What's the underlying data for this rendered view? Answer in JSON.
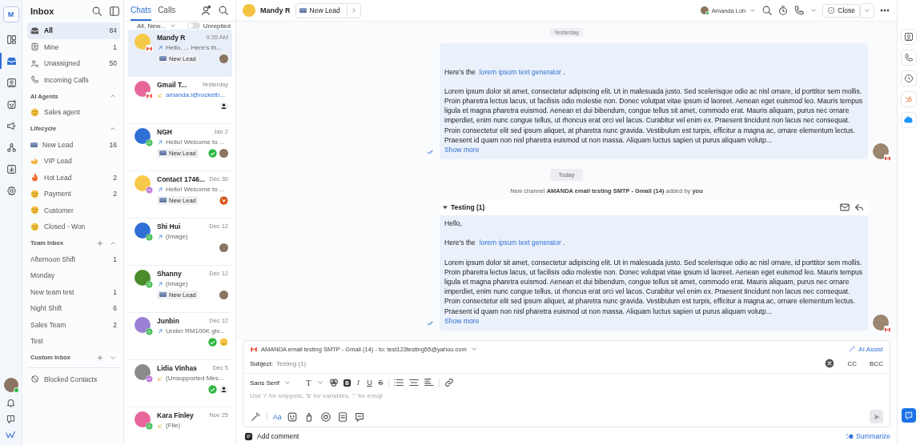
{
  "rail": {
    "logo": "M",
    "items": [
      {
        "kind": "columns",
        "selected": false
      },
      {
        "kind": "inbox",
        "selected": true
      },
      {
        "kind": "contact",
        "selected": false
      },
      {
        "kind": "bot",
        "selected": false
      },
      {
        "kind": "megaphone",
        "selected": false
      },
      {
        "kind": "flow",
        "selected": false
      },
      {
        "kind": "report",
        "selected": false
      },
      {
        "kind": "gear",
        "selected": false
      }
    ],
    "user": {
      "online": true
    }
  },
  "inbox": {
    "title": "Inbox",
    "items": [
      {
        "label": "All",
        "count": "84",
        "kind": "inbox",
        "selected": true
      },
      {
        "label": "Mine",
        "count": "1",
        "kind": "user",
        "selected": false
      },
      {
        "label": "Unassigned",
        "count": "50",
        "kind": "unassigned",
        "selected": false
      },
      {
        "label": "Incoming Calls",
        "kind": "phone",
        "selected": false
      }
    ],
    "sections": [
      {
        "title": "AI Agents",
        "expanded": true,
        "addable": false,
        "items": [
          {
            "label": "Sales agent",
            "kind": "face",
            "selected": false
          }
        ]
      },
      {
        "title": "Lifecycle",
        "expanded": true,
        "addable": false,
        "items": [
          {
            "label": "New Lead",
            "count": "16",
            "kind": "badge",
            "selected": false
          },
          {
            "label": "VIP Lead",
            "kind": "hand",
            "selected": false
          },
          {
            "label": "Hot Lead",
            "count": "2",
            "kind": "flame",
            "selected": false
          },
          {
            "label": "Payment",
            "count": "2",
            "kind": "face",
            "selected": false
          },
          {
            "label": "Customer",
            "kind": "face",
            "selected": false
          },
          {
            "label": "Closed - Won",
            "kind": "face",
            "selected": false
          }
        ]
      },
      {
        "title": "Team Inbox",
        "expanded": true,
        "addable": true,
        "items": [
          {
            "label": "Afternoon Shift",
            "count": "1",
            "selected": false
          },
          {
            "label": "Monday",
            "selected": false
          },
          {
            "label": "New team test",
            "count": "1",
            "selected": false
          },
          {
            "label": "Night Shift",
            "count": "6",
            "selected": false
          },
          {
            "label": "Sales Team",
            "count": "2",
            "selected": false
          },
          {
            "label": "Test",
            "selected": false
          }
        ]
      },
      {
        "title": "Custom Inbox",
        "expanded": false,
        "addable": true
      }
    ],
    "footer": {
      "label": "Blocked Contacts"
    }
  },
  "chat_list": {
    "tabs": [
      {
        "label": "Chats",
        "selected": true
      },
      {
        "label": "Calls",
        "selected": false
      }
    ],
    "filter": "All, New...",
    "unreplied": {
      "label": "Unreplied",
      "on": false
    },
    "chats": [
      {
        "name": "Mandy R",
        "time": "9:35 AM",
        "kind": "outgoing",
        "preview": "Hello, ... Here's th...",
        "link": false,
        "tag": "New Lead",
        "replied": false,
        "assignee": {
          "kind": "photo"
        },
        "channel": {
          "kind": "gmail"
        },
        "color": "#f7c948",
        "selected": true
      },
      {
        "name": "Gmail T...",
        "time": "Yesterday",
        "kind": "incoming",
        "preview": "amanda.l@rocketb...",
        "link": true,
        "replied": false,
        "assignee": {
          "kind": "person"
        },
        "channel": {
          "kind": "gmail"
        },
        "color": "#e8679b",
        "selected": false
      },
      {
        "name": "NGH",
        "time": "Jan 2",
        "kind": "outgoing",
        "preview": "Hello! Welcome to ...",
        "link": false,
        "tag": "New Lead",
        "replied": true,
        "assignee": {
          "kind": "photo"
        },
        "channel": {
          "kind": "whatsapp"
        },
        "color": "#2f6fd6",
        "selected": false
      },
      {
        "name": "Contact 1746...",
        "time": "Dec 30",
        "kind": "outgoing",
        "preview": "Hello! Welcome to ...",
        "link": false,
        "tag": "New Lead",
        "replied": false,
        "assignee": {
          "kind": "brand"
        },
        "channel": {
          "kind": "messenger"
        },
        "color": "#f7c948",
        "selected": false
      },
      {
        "name": "Shi Hui",
        "time": "Dec 12",
        "kind": "outgoing",
        "preview": "(Image)",
        "link": false,
        "replied": false,
        "assignee": {
          "kind": "photo"
        },
        "channel": {
          "kind": "whatsapp"
        },
        "color": "#2f6fd6",
        "selected": false
      },
      {
        "name": "Shanny",
        "time": "Dec 12",
        "kind": "outgoing",
        "preview": "(Image)",
        "link": false,
        "tag": "New Lead",
        "replied": false,
        "assignee": {
          "kind": "photo"
        },
        "channel": {
          "kind": "whatsapp"
        },
        "color": "#4a8c2a",
        "selected": false
      },
      {
        "name": "Junbin",
        "time": "Dec 12",
        "kind": "outgoing",
        "preview": "Under RM100K giv...",
        "link": false,
        "replied": true,
        "assignee": {
          "kind": "emoji"
        },
        "channel": {
          "kind": "whatsapp"
        },
        "color": "#9b7fd4",
        "selected": false
      },
      {
        "name": "Lidia Vinhas",
        "time": "Dec 5",
        "kind": "incoming",
        "preview": "(Unsupported Mes...",
        "link": false,
        "replied": true,
        "assignee": {
          "kind": "person"
        },
        "channel": {
          "kind": "messenger"
        },
        "color": "#8a8a8a",
        "selected": false
      },
      {
        "name": "Kara Finley",
        "time": "Nov 25",
        "kind": "incoming",
        "preview": "(File)",
        "link": false,
        "replied": false,
        "channel": {
          "kind": "whatsapp"
        },
        "color": "#e8679b",
        "selected": false
      }
    ]
  },
  "conversation": {
    "contact": "Mandy R",
    "stage": "New Lead",
    "agent": "Amanda Loh",
    "close_label": "Close",
    "timeline": [
      {
        "kind": "message",
        "intro": "Here's the",
        "link": "lorem ipsum text generator",
        "suffix": ".",
        "body": "Lorem ipsum dolor sit amet, consectetur adipiscing elit. Ut in malesuada justo. Sed scelerisque odio ac nisl ornare, id porttitor sem mollis. Proin pharetra lectus lacus, ut facilisis odio molestie non. Donec volutpat vitae ipsum id laoreet. Aenean eget euismod leo. Mauris tempus ligula et magna pharetra euismod. Aenean et dui bibendum, congue tellus sit amet, commodo erat. Mauris aliquam, purus nec ornare imperdiet, enim nunc congue tellus, ut rhoncus erat orci vel lacus. Curabitur vel enim ex. Praesent tincidunt non lacus nec consequat. Proin consectetur elit sed ipsum aliquet, at pharetra nunc gravida. Vestibulum est turpis, efficitur a magna ac, ornare elementum lectus. Praesent id quam non nisl pharetra euismod ut non massa. Aliquam luctus sapien ut purus aliquam volutp...",
        "more": "Show more"
      },
      {
        "kind": "day",
        "label": "Today"
      },
      {
        "kind": "note",
        "text": "New channel **AMANDA email testing SMTP - Gmail (14)** added by **you**"
      },
      {
        "kind": "message",
        "subject": "Testing (1)",
        "greeting": "Hello,",
        "intro": "Here's the",
        "link": "lorem ipsum text generator",
        "suffix": ".",
        "body": "Lorem ipsum dolor sit amet, consectetur adipiscing elit. Ut in malesuada justo. Sed scelerisque odio ac nisl ornare, id porttitor sem mollis. Proin pharetra lectus lacus, ut facilisis odio molestie non. Donec volutpat vitae ipsum id laoreet. Aenean eget euismod leo. Mauris tempus ligula et magna pharetra euismod. Aenean et dui bibendum, congue tellus sit amet, commodo erat. Mauris aliquam, purus nec ornare imperdiet, enim nunc congue tellus, ut rhoncus erat orci vel lacus. Curabitur vel enim ex. Praesent tincidunt non lacus nec consequat. Proin consectetur elit sed ipsum aliquet, at pharetra nunc gravida. Vestibulum est turpis, efficitur a magna ac, ornare elementum lectus. Praesent id quam non nisl pharetra euismod ut non massa. Aliquam luctus sapien ut purus aliquam volutp...",
        "more": "Show more"
      }
    ],
    "sticky_day": "Yesterday",
    "composer": {
      "from": "AMANDA email testing SMTP - Gmail (14) - to: test123testing55@yahoo.com",
      "ai_assist": "AI Assist",
      "subject_label": "Subject:",
      "subject": "Testing (1)",
      "cc": "CC",
      "bcc": "BCC",
      "font": "Sans Serif",
      "format_buttons": [
        {
          "label": "T",
          "kind": "size"
        },
        {
          "label": "B",
          "kind": "bold"
        },
        {
          "label": "I",
          "kind": "italic"
        },
        {
          "label": "U",
          "kind": "underline"
        },
        {
          "label": "S",
          "kind": "strike"
        }
      ],
      "placeholder": "Use '/' for snippets, '$' for variables, ':' for emoji",
      "text_style": "Aa"
    },
    "add_comment": "Add comment",
    "summarize": "Summarize"
  }
}
